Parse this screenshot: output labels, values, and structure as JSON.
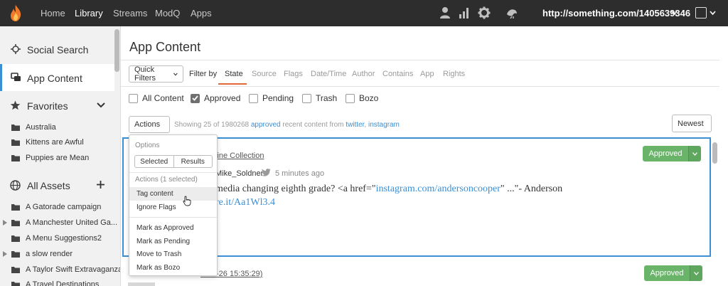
{
  "nav": {
    "links": [
      "Home",
      "Library",
      "Streams",
      "ModQ",
      "Apps"
    ],
    "active": "Library",
    "icons": [
      "user-icon",
      "bar-chart-icon",
      "gear-icon",
      "bird-icon"
    ],
    "url": "http://something.com/1405639346"
  },
  "sidebar": {
    "social_search": "Social Search",
    "app_content": "App Content",
    "favorites": "Favorites",
    "favorite_items": [
      "Australia",
      "Kittens are Awful",
      "Puppies are Mean"
    ],
    "all_assets": "All Assets",
    "asset_items": [
      "A Gatorade campaign",
      "A Manchester United Ga...",
      "A Menu Suggestions2",
      "a slow render",
      "A Taylor Swift Extravaganza",
      "A Travel Destinations"
    ]
  },
  "main": {
    "title": "App Content",
    "quick_filters": "Quick Filters",
    "filter_by": "Filter by",
    "filter_tabs": [
      "State",
      "Source",
      "Flags",
      "Date/Time",
      "Author",
      "Contains",
      "App",
      "Rights"
    ],
    "states": [
      {
        "label": "All Content",
        "checked": false
      },
      {
        "label": "Approved",
        "checked": true
      },
      {
        "label": "Pending",
        "checked": false
      },
      {
        "label": "Trash",
        "checked": false
      },
      {
        "label": "Bozo",
        "checked": false
      }
    ],
    "actions_label": "Actions",
    "showing_prefix": "Showing 25 of 1980268",
    "showing_state": "approved",
    "showing_mid": "recent content from",
    "showing_src1": "twitter",
    "showing_comma": ",",
    "showing_src2": "instagram",
    "sort_label": "Newest"
  },
  "card": {
    "collection": "line Collection",
    "author": "Mike_Soldner",
    "time": "5 minutes ago",
    "text_pre": "media changing eighth grade? <a href=\"",
    "text_link": "instagram.com/andersoncooper",
    "text_post": "\" ...\"- Anderson",
    "text_link2": "re.it/Aa1Wl3.4",
    "status": "Approved"
  },
  "card2": {
    "date": "5-08-26 15:35:29)",
    "status": "Approved"
  },
  "menu": {
    "options_head": "Options",
    "seg_selected": "Selected",
    "seg_results": "Results",
    "actions_head": "Actions (1 selected)",
    "items_a": [
      "Tag content",
      "Ignore Flags"
    ],
    "items_b": [
      "Mark as Approved",
      "Mark as Pending",
      "Move to Trash",
      "Mark as Bozo"
    ]
  },
  "colors": {
    "accent": "#3a8fd5",
    "approved": "#6ab46a",
    "nav_bg": "#2d2d2d",
    "tab_underline": "#e5683a"
  }
}
